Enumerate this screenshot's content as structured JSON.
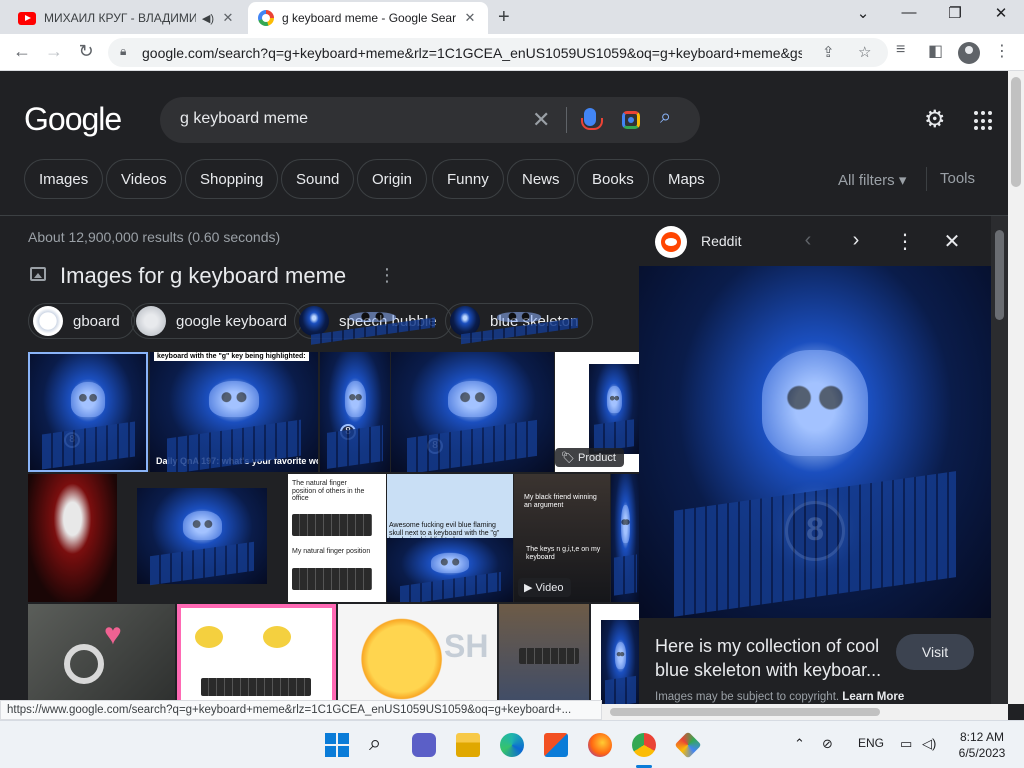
{
  "browser": {
    "tabs": [
      {
        "title": "МИХАИЛ КРУГ - ВЛАДИМИ",
        "active": false,
        "icon": "youtube-icon"
      },
      {
        "title": "g keyboard meme - Google Sear",
        "active": true,
        "icon": "google-icon"
      }
    ],
    "url": "google.com/search?q=g+keyboard+meme&rlz=1C1GCEA_enUS1059US1059&oq=g+keyboard+meme&gs..."
  },
  "google": {
    "logo": "Google",
    "query": "g keyboard meme",
    "chips": [
      "Images",
      "Videos",
      "Shopping",
      "Sound",
      "Origin",
      "Funny",
      "News",
      "Books",
      "Maps"
    ],
    "all_filters": "All filters ▾",
    "tools": "Tools",
    "results_count": "About 12,900,000 results (0.60 seconds)",
    "section_title": "Images for g keyboard meme",
    "related": [
      "gboard",
      "google keyboard",
      "speech bubble",
      "blue skeleton"
    ]
  },
  "grid": {
    "caption_top": "keyboard with the \"g\" key being highlighted:",
    "caption_bottom": "Daily QnA 197: what's your favorite wo",
    "product_badge": "Product",
    "video_badge": "Video",
    "finger_top": "The natural finger position of others in the office",
    "finger_bottom": "My natural finger position",
    "awesome_text": "Awesome fucking evil blue flaming skull next to a keyboard with the \"g\" key being highlighted",
    "friend_text": "My black friend winning an argument",
    "keys_text": "The keys n g,i,t,e on my keyboard"
  },
  "panel": {
    "source": "Reddit",
    "title": "Here is my collection of cool blue skeleton with keyboar...",
    "visit": "Visit",
    "copyright": "Images may be subject to copyright.",
    "learn_more": "Learn More"
  },
  "status_url": "https://www.google.com/search?q=g+keyboard+meme&rlz=1C1GCEA_enUS1059US1059&oq=g+keyboard+...",
  "taskbar": {
    "language": "ENG",
    "time": "8:12 AM",
    "date": "6/5/2023"
  },
  "colors": {
    "page_bg": "#202124",
    "text": "#e8eaed",
    "muted": "#9aa0a6",
    "link_blue": "#8ab4f8",
    "chip_border": "#3c4043"
  }
}
